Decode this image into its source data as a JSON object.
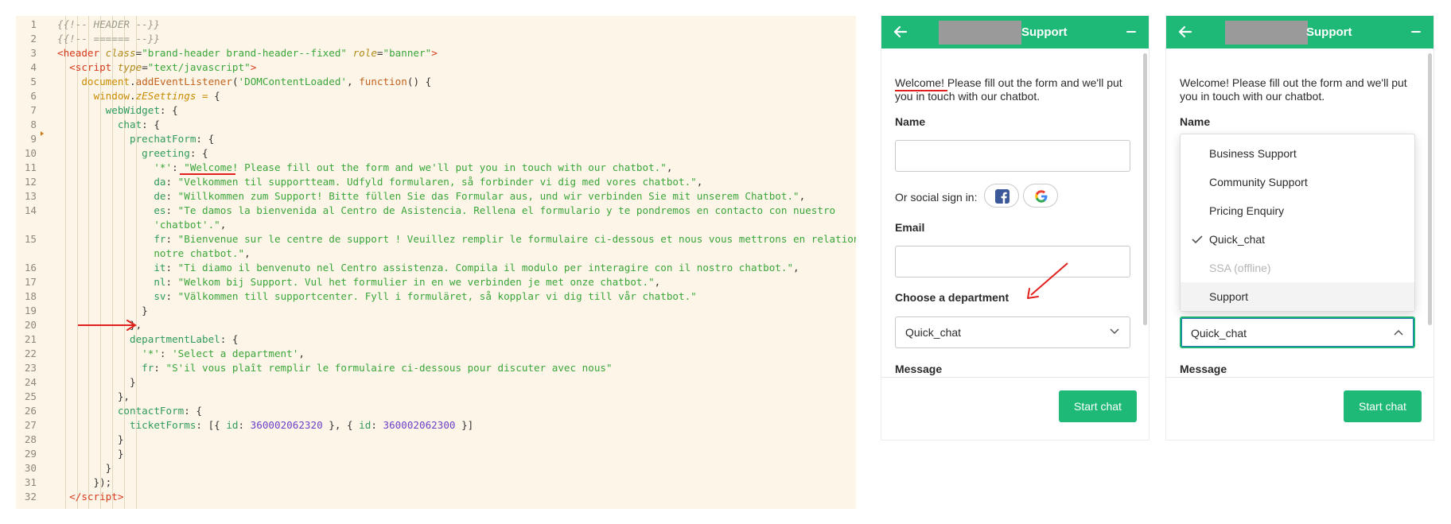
{
  "code": {
    "line_numbers": [
      "1",
      "2",
      "3",
      "4",
      "5",
      "6",
      "7",
      "8",
      "9",
      "10",
      "11",
      "12",
      "13",
      "14",
      "",
      "15",
      "",
      "16",
      "17",
      "18",
      "19",
      "20",
      "21",
      "22",
      "23",
      "24",
      "25",
      "26",
      "27",
      "28",
      "29",
      "30",
      "31",
      "32"
    ],
    "lines": [
      [
        {
          "t": "c",
          "v": "{{!-- HEADER --}}"
        }
      ],
      [
        {
          "t": "c",
          "v": "{{!-- ====== --}}"
        }
      ],
      [
        {
          "t": "t",
          "v": "<header "
        },
        {
          "t": "a",
          "v": "class"
        },
        {
          "t": "p",
          "v": "="
        },
        {
          "t": "s",
          "v": "\"brand-header brand-header--fixed\""
        },
        {
          "t": "p",
          "v": " "
        },
        {
          "t": "a",
          "v": "role"
        },
        {
          "t": "p",
          "v": "="
        },
        {
          "t": "s",
          "v": "\"banner\""
        },
        {
          "t": "t",
          "v": ">"
        }
      ],
      [
        {
          "t": "p",
          "v": "  "
        },
        {
          "t": "t",
          "v": "<script "
        },
        {
          "t": "a",
          "v": "type"
        },
        {
          "t": "p",
          "v": "="
        },
        {
          "t": "s",
          "v": "\"text/javascript\""
        },
        {
          "t": "t",
          "v": ">"
        }
      ],
      [
        {
          "t": "p",
          "v": "    "
        },
        {
          "t": "o",
          "v": "document"
        },
        {
          "t": "p",
          "v": "."
        },
        {
          "t": "f",
          "v": "addEventListener"
        },
        {
          "t": "p",
          "v": "("
        },
        {
          "t": "s",
          "v": "'DOMContentLoaded'"
        },
        {
          "t": "p",
          "v": ", "
        },
        {
          "t": "f",
          "v": "function"
        },
        {
          "t": "p",
          "v": "() {"
        }
      ],
      [
        {
          "t": "p",
          "v": "      "
        },
        {
          "t": "o",
          "v": "window"
        },
        {
          "t": "p",
          "v": "."
        },
        {
          "t": "v",
          "v": "zESettings"
        },
        {
          "t": "o",
          "v": " = "
        },
        {
          "t": "p",
          "v": "{"
        }
      ],
      [
        {
          "t": "p",
          "v": "        "
        },
        {
          "t": "k",
          "v": "webWidget"
        },
        {
          "t": "p",
          "v": ": {"
        }
      ],
      [
        {
          "t": "p",
          "v": "          "
        },
        {
          "t": "k",
          "v": "chat"
        },
        {
          "t": "p",
          "v": ": {"
        }
      ],
      [
        {
          "t": "p",
          "v": "            "
        },
        {
          "t": "k",
          "v": "prechatForm"
        },
        {
          "t": "p",
          "v": ": {"
        }
      ],
      [
        {
          "t": "p",
          "v": "              "
        },
        {
          "t": "k",
          "v": "greeting"
        },
        {
          "t": "p",
          "v": ": {"
        }
      ],
      [
        {
          "t": "p",
          "v": "                "
        },
        {
          "t": "s",
          "v": "'*'"
        },
        {
          "t": "p",
          "v": ": "
        },
        {
          "t": "s",
          "v": "\"Welcome! Please fill out the form and we'll put you in touch with our chatbot.\""
        },
        {
          "t": "p",
          "v": ","
        }
      ],
      [
        {
          "t": "p",
          "v": "                "
        },
        {
          "t": "k",
          "v": "da"
        },
        {
          "t": "p",
          "v": ": "
        },
        {
          "t": "s",
          "v": "\"Velkommen til supportteam. Udfyld formularen, så forbinder vi dig med vores chatbot.\""
        },
        {
          "t": "p",
          "v": ","
        }
      ],
      [
        {
          "t": "p",
          "v": "                "
        },
        {
          "t": "k",
          "v": "de"
        },
        {
          "t": "p",
          "v": ": "
        },
        {
          "t": "s",
          "v": "\"Willkommen zum Support! Bitte füllen Sie das Formular aus, und wir verbinden Sie mit unserem Chatbot.\""
        },
        {
          "t": "p",
          "v": ","
        }
      ],
      [
        {
          "t": "p",
          "v": "                "
        },
        {
          "t": "k",
          "v": "es"
        },
        {
          "t": "p",
          "v": ": "
        },
        {
          "t": "s",
          "v": "\"Te damos la bienvenida al Centro de Asistencia. Rellena el formulario y te pondremos en contacto con nuestro"
        }
      ],
      [
        {
          "t": "p",
          "v": "                "
        },
        {
          "t": "s",
          "v": "'chatbot'.\""
        },
        {
          "t": "p",
          "v": ","
        }
      ],
      [
        {
          "t": "p",
          "v": "                "
        },
        {
          "t": "k",
          "v": "fr"
        },
        {
          "t": "p",
          "v": ": "
        },
        {
          "t": "s",
          "v": "\"Bienvenue sur le centre de support ! Veuillez remplir le formulaire ci-dessous et nous vous mettrons en relation avec"
        }
      ],
      [
        {
          "t": "p",
          "v": "                "
        },
        {
          "t": "s",
          "v": "notre chatbot.\""
        },
        {
          "t": "p",
          "v": ","
        }
      ],
      [
        {
          "t": "p",
          "v": "                "
        },
        {
          "t": "k",
          "v": "it"
        },
        {
          "t": "p",
          "v": ": "
        },
        {
          "t": "s",
          "v": "\"Ti diamo il benvenuto nel Centro assistenza. Compila il modulo per interagire con il nostro chatbot.\""
        },
        {
          "t": "p",
          "v": ","
        }
      ],
      [
        {
          "t": "p",
          "v": "                "
        },
        {
          "t": "k",
          "v": "nl"
        },
        {
          "t": "p",
          "v": ": "
        },
        {
          "t": "s",
          "v": "\"Welkom bij Support. Vul het formulier in en we verbinden je met onze chatbot.\""
        },
        {
          "t": "p",
          "v": ","
        }
      ],
      [
        {
          "t": "p",
          "v": "                "
        },
        {
          "t": "k",
          "v": "sv"
        },
        {
          "t": "p",
          "v": ": "
        },
        {
          "t": "s",
          "v": "\"Välkommen till supportcenter. Fyll i formuläret, så kopplar vi dig till vår chatbot.\""
        }
      ],
      [
        {
          "t": "p",
          "v": "              }"
        }
      ],
      [
        {
          "t": "p",
          "v": "            },"
        }
      ],
      [
        {
          "t": "p",
          "v": "            "
        },
        {
          "t": "k",
          "v": "departmentLabel"
        },
        {
          "t": "p",
          "v": ": {"
        }
      ],
      [
        {
          "t": "p",
          "v": "              "
        },
        {
          "t": "s",
          "v": "'*'"
        },
        {
          "t": "p",
          "v": ": "
        },
        {
          "t": "s",
          "v": "'Select a department'"
        },
        {
          "t": "p",
          "v": ","
        }
      ],
      [
        {
          "t": "p",
          "v": "              "
        },
        {
          "t": "k",
          "v": "fr"
        },
        {
          "t": "p",
          "v": ": "
        },
        {
          "t": "s",
          "v": "\"S'il vous plaît remplir le formulaire ci-dessous pour discuter avec nous\""
        }
      ],
      [
        {
          "t": "p",
          "v": "            }"
        }
      ],
      [
        {
          "t": "p",
          "v": "          },"
        }
      ],
      [
        {
          "t": "p",
          "v": "          "
        },
        {
          "t": "k",
          "v": "contactForm"
        },
        {
          "t": "p",
          "v": ": {"
        }
      ],
      [
        {
          "t": "p",
          "v": "            "
        },
        {
          "t": "k",
          "v": "ticketForms"
        },
        {
          "t": "p",
          "v": ": [{ "
        },
        {
          "t": "k",
          "v": "id"
        },
        {
          "t": "p",
          "v": ": "
        },
        {
          "t": "n",
          "v": "360002062320"
        },
        {
          "t": "p",
          "v": " }, { "
        },
        {
          "t": "k",
          "v": "id"
        },
        {
          "t": "p",
          "v": ": "
        },
        {
          "t": "n",
          "v": "360002062300"
        },
        {
          "t": "p",
          "v": " }]"
        }
      ],
      [
        {
          "t": "p",
          "v": "          }"
        }
      ],
      [
        {
          "t": "p",
          "v": "          }"
        }
      ],
      [
        {
          "t": "p",
          "v": "        }"
        }
      ],
      [
        {
          "t": "p",
          "v": "      });"
        }
      ],
      [
        {
          "t": "p",
          "v": "  "
        },
        {
          "t": "t",
          "v": "</"
        },
        {
          "t": "t",
          "v": "script"
        },
        {
          "t": "t",
          "v": ">"
        }
      ]
    ]
  },
  "widgets": [
    {
      "title": "Support",
      "greeting": "Welcome! Please fill out the form and we'll put you in touch with our chatbot.",
      "name_label": "Name",
      "social_label": "Or social sign in:",
      "email_label": "Email",
      "department_label": "Choose a department",
      "department_value": "Quick_chat",
      "message_label": "Message",
      "start_button": "Start chat"
    },
    {
      "title": "Support",
      "greeting": "Welcome! Please fill out the form and we'll put you in touch with our chatbot.",
      "name_label": "Name",
      "department_value": "Quick_chat",
      "message_label": "Message",
      "start_button": "Start chat",
      "dropdown_options": [
        "Business Support",
        "Community Support",
        "Pricing Enquiry",
        "Quick_chat",
        "SSA (offline)",
        "Support"
      ],
      "selected_option": "Quick_chat",
      "disabled_option": "SSA (offline)",
      "hovered_option": "Support"
    }
  ],
  "colors": {
    "brand_green": "#1fb977",
    "editor_bg": "#fdf6e8",
    "annotation_red": "#e0201c"
  },
  "icons": [
    "back-arrow-icon",
    "minimize-icon",
    "facebook-icon",
    "google-icon",
    "chevron-down-icon",
    "chevron-up-icon",
    "checkmark-icon"
  ]
}
